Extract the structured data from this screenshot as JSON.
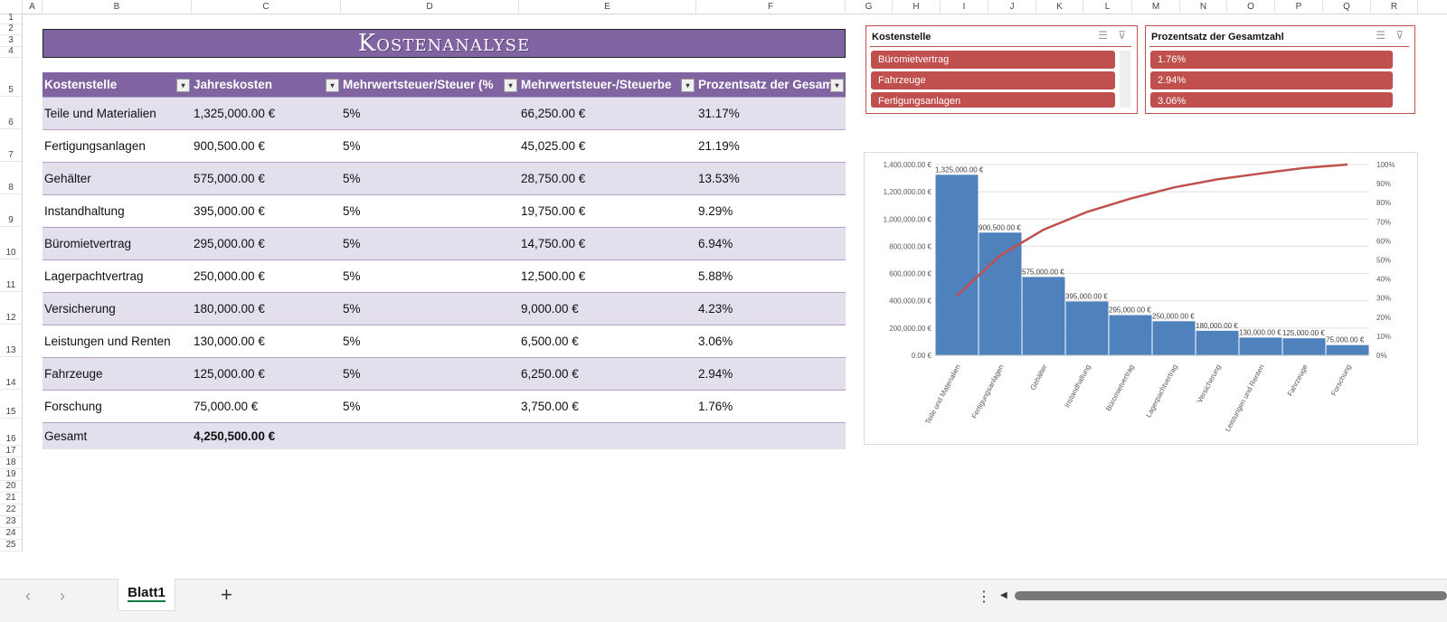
{
  "columns": [
    "A",
    "B",
    "C",
    "D",
    "E",
    "F",
    "G",
    "H",
    "I",
    "J",
    "K",
    "L",
    "M",
    "N",
    "O",
    "P",
    "Q",
    "R"
  ],
  "rows": [
    "1",
    "2",
    "3",
    "4",
    "5",
    "6",
    "7",
    "8",
    "9",
    "10",
    "11",
    "12",
    "13",
    "14",
    "15",
    "16",
    "17",
    "18",
    "19",
    "20",
    "21",
    "22",
    "23",
    "24",
    "25"
  ],
  "title": "Kostenanalyse",
  "table": {
    "headers": [
      "Kostenstelle",
      "Jahreskosten",
      "Mehrwertsteuer/Steuer (%",
      "Mehrwertsteuer-/Steuerbe",
      "Prozentsatz der Gesam"
    ],
    "rows": [
      [
        "Teile und Materialien",
        "1,325,000.00 €",
        "5%",
        "66,250.00 €",
        "31.17%"
      ],
      [
        "Fertigungsanlagen",
        "900,500.00 €",
        "5%",
        "45,025.00 €",
        "21.19%"
      ],
      [
        "Gehälter",
        "575,000.00 €",
        "5%",
        "28,750.00 €",
        "13.53%"
      ],
      [
        "Instandhaltung",
        "395,000.00 €",
        "5%",
        "19,750.00 €",
        "9.29%"
      ],
      [
        "Büromietvertrag",
        "295,000.00 €",
        "5%",
        "14,750.00 €",
        "6.94%"
      ],
      [
        "Lagerpachtvertrag",
        "250,000.00 €",
        "5%",
        "12,500.00 €",
        "5.88%"
      ],
      [
        "Versicherung",
        "180,000.00 €",
        "5%",
        "9,000.00 €",
        "4.23%"
      ],
      [
        "Leistungen und Renten",
        "130,000.00 €",
        "5%",
        "6,500.00 €",
        "3.06%"
      ],
      [
        "Fahrzeuge",
        "125,000.00 €",
        "5%",
        "6,250.00 €",
        "2.94%"
      ],
      [
        "Forschung",
        "75,000.00 €",
        "5%",
        "3,750.00 €",
        "1.76%"
      ]
    ],
    "total": {
      "label": "Gesamt",
      "value": "4,250,500.00 €"
    }
  },
  "slicers": [
    {
      "title": "Kostenstelle",
      "items": [
        "Büromietvertrag",
        "Fahrzeuge",
        "Fertigungsanlagen"
      ]
    },
    {
      "title": "Prozentsatz der Gesamtzahl",
      "items": [
        "1.76%",
        "2.94%",
        "3.06%"
      ]
    }
  ],
  "chart_data": {
    "type": "bar",
    "categories": [
      "Teile und Materialien",
      "Fertigungsanlagen",
      "Gehälter",
      "Instandhaltung",
      "Büromietvertrag",
      "Lagerpachtvertrag",
      "Versicherung",
      "Leistungen und Renten",
      "Fahrzeuge",
      "Forschung"
    ],
    "values": [
      1325000,
      900500,
      575000,
      395000,
      295000,
      250000,
      180000,
      130000,
      125000,
      75000
    ],
    "data_labels": [
      "1,325,000.00 €",
      "900,500.00 €",
      "575,000.00 €",
      "395,000.00 €",
      "295,000.00 €",
      "250,000.00 €",
      "180,000.00 €",
      "130,000.00 €",
      "125,000.00 €",
      "75,000.00 €"
    ],
    "cumulative_percent": [
      31.17,
      52.36,
      65.89,
      75.18,
      82.12,
      88.0,
      92.23,
      95.29,
      98.24,
      100
    ],
    "ylim": [
      0,
      1400000
    ],
    "y_ticks": [
      "0.00 €",
      "200,000.00 €",
      "400,000.00 €",
      "600,000.00 €",
      "800,000.00 €",
      "1,000,000.00 €",
      "1,200,000.00 €",
      "1,400,000.00 €"
    ],
    "y2lim": [
      0,
      100
    ],
    "y2_ticks": [
      "0%",
      "10%",
      "20%",
      "30%",
      "40%",
      "50%",
      "60%",
      "70%",
      "80%",
      "90%",
      "100%"
    ],
    "bar_color": "#4f81bd",
    "line_color": "#c0504d",
    "grid": true
  },
  "sheet_tab": "Blatt1",
  "add_sheet": "+"
}
